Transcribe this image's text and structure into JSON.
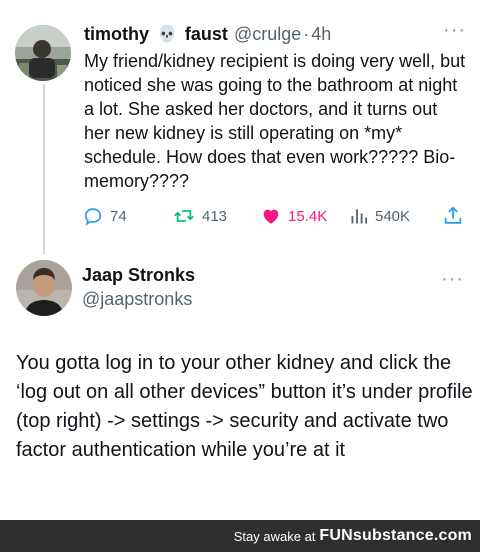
{
  "tweet1": {
    "display_name_part1": "timothy",
    "skull": "💀",
    "display_name_part2": "faust",
    "handle": "@crulge",
    "separator": "·",
    "time": "4h",
    "more": "···",
    "text": "My friend/kidney recipient is doing very well, but noticed she was going to the bathroom at night a lot. She asked her doctors, and it turns out her new kidney is still operating on *my* schedule. How does that even work????? Bio-memory????",
    "stats": {
      "replies": "74",
      "retweets": "413",
      "likes": "15.4K",
      "views": "540K"
    },
    "liked_color": "#f91880"
  },
  "tweet2": {
    "display_name": "Jaap Stronks",
    "handle": "@jaapstronks",
    "more": "···",
    "text": "You gotta log in to your other kidney and click the ‘log out on all other devices” button it’s under profile (top right) -> settings -> security and activate two factor authentication while you’re at it"
  },
  "footer": {
    "tagline": "Stay awake at",
    "brand": "FUNsubstance.com"
  }
}
